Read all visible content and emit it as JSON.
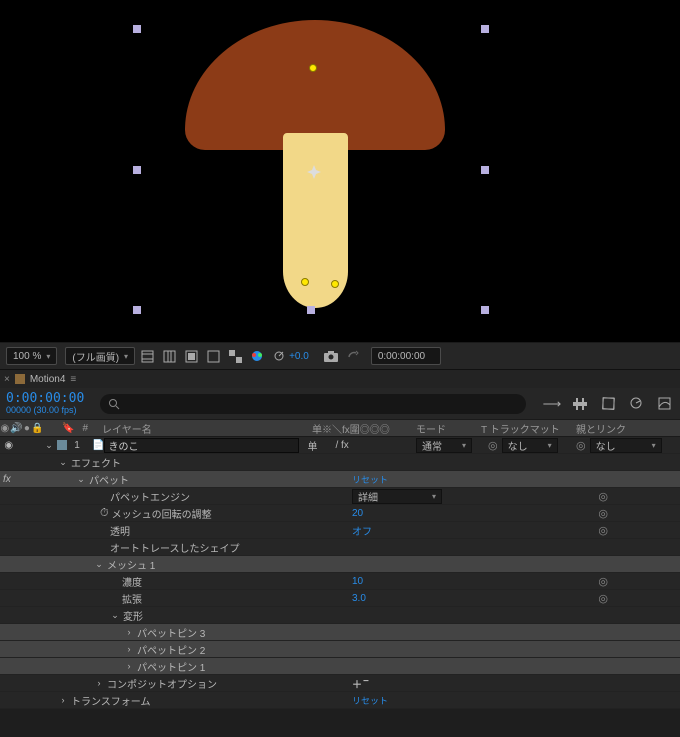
{
  "viewer": {
    "zoom": "100 %",
    "quality": "(フル画質)",
    "exposure": "+0.0",
    "time": "0:00:00:00"
  },
  "timeline": {
    "tab": "Motion4",
    "current_time": "0:00:00:00",
    "frame_sub": "00000 (30.00 fps)",
    "search_placeholder": ""
  },
  "columns": {
    "num": "#",
    "name": "レイヤー名",
    "switches": "单※＼fx圍◎◎◎",
    "mode": "モード",
    "track": "T トラックマット",
    "parent": "親とリンク"
  },
  "layer": {
    "index": "1",
    "name": "きのこ",
    "quality_char": "单",
    "fx_char": "/ fx",
    "mode": "通常",
    "matte_at": "◎",
    "matte": "なし",
    "parent_at": "◎",
    "parent": "なし"
  },
  "effects_header": "エフェクト",
  "puppet": {
    "label": "パペット",
    "reset": "リセット",
    "engine": {
      "label": "パペットエンジン",
      "value": "詳細"
    },
    "rotation": {
      "label": "メッシュの回転の調整",
      "value": "20"
    },
    "transparent": {
      "label": "透明",
      "value": "オフ"
    },
    "autotrace": "オートトレースしたシェイプ",
    "mesh": {
      "label": "メッシュ 1",
      "density": {
        "label": "濃度",
        "value": "10"
      },
      "expansion": {
        "label": "拡張",
        "value": "3.0"
      },
      "deform": "変形",
      "pins": [
        "パペットピン 3",
        "パペットピン 2",
        "パペットピン 1"
      ]
    }
  },
  "composite": {
    "label": "コンポジットオプション",
    "add": "＋",
    "minus": "−"
  },
  "transform": {
    "label": "トランスフォーム",
    "reset": "リセット"
  }
}
